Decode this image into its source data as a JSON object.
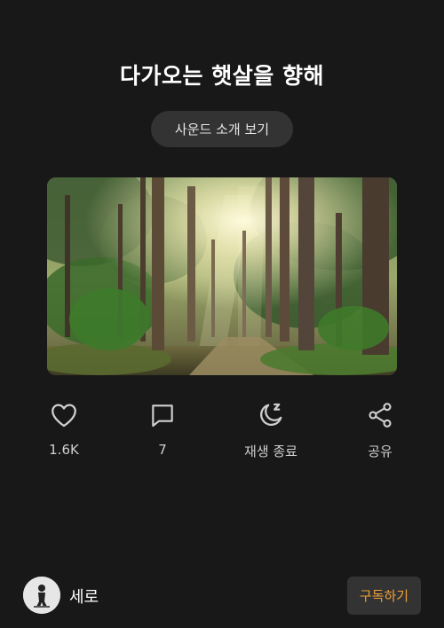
{
  "header": {
    "title": "다가오는 햇살을 향해",
    "intro_button_label": "사운드 소개 보기"
  },
  "cover": {
    "image_description": "forest-path-sunlight"
  },
  "actions": [
    {
      "icon": "heart-icon",
      "label": "1.6K"
    },
    {
      "icon": "comment-icon",
      "label": "7"
    },
    {
      "icon": "moon-sleep-icon",
      "label": "재생 종료"
    },
    {
      "icon": "share-icon",
      "label": "공유"
    }
  ],
  "footer": {
    "channel_name": "세로",
    "subscribe_label": "구독하기"
  },
  "colors": {
    "background": "#181818",
    "button_bg": "#333333",
    "accent_orange": "#f0a13a",
    "icon": "#d0d0d0"
  }
}
